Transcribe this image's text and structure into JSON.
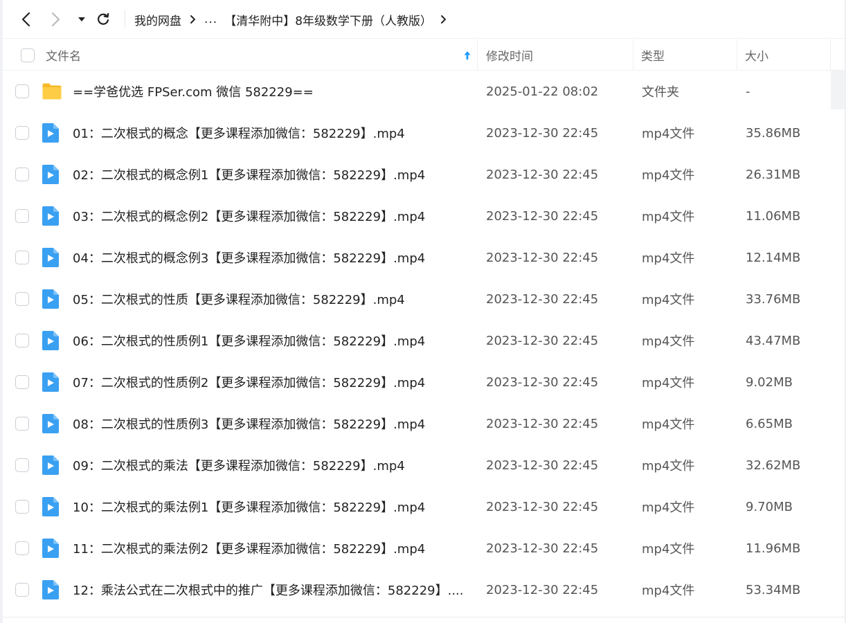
{
  "nav": {
    "back_icon": "chevron-left-icon",
    "forward_icon": "chevron-right-icon",
    "dropdown_icon": "caret-down-icon",
    "refresh_icon": "refresh-icon"
  },
  "breadcrumb": {
    "root": "我的网盘",
    "ellipsis": "...",
    "current": "【清华附中】8年级数学下册（人教版）"
  },
  "table": {
    "headers": {
      "name": "文件名",
      "modified": "修改时间",
      "type": "类型",
      "size": "大小"
    },
    "sort_icon": "arrow-up-icon",
    "rows": [
      {
        "icon": "folder-icon",
        "name": "==学爸优选 FPSer.com 微信 582229==",
        "modified": "2025-01-22 08:02",
        "type": "文件夹",
        "size": "-"
      },
      {
        "icon": "video-file-icon",
        "name": "01：二次根式的概念【更多课程添加微信：582229】.mp4",
        "modified": "2023-12-30 22:45",
        "type": "mp4文件",
        "size": "35.86MB"
      },
      {
        "icon": "video-file-icon",
        "name": "02：二次根式的概念例1【更多课程添加微信：582229】.mp4",
        "modified": "2023-12-30 22:45",
        "type": "mp4文件",
        "size": "26.31MB"
      },
      {
        "icon": "video-file-icon",
        "name": "03：二次根式的概念例2【更多课程添加微信：582229】.mp4",
        "modified": "2023-12-30 22:45",
        "type": "mp4文件",
        "size": "11.06MB"
      },
      {
        "icon": "video-file-icon",
        "name": "04：二次根式的概念例3【更多课程添加微信：582229】.mp4",
        "modified": "2023-12-30 22:45",
        "type": "mp4文件",
        "size": "12.14MB"
      },
      {
        "icon": "video-file-icon",
        "name": "05：二次根式的性质【更多课程添加微信：582229】.mp4",
        "modified": "2023-12-30 22:45",
        "type": "mp4文件",
        "size": "33.76MB"
      },
      {
        "icon": "video-file-icon",
        "name": "06：二次根式的性质例1【更多课程添加微信：582229】.mp4",
        "modified": "2023-12-30 22:45",
        "type": "mp4文件",
        "size": "43.47MB"
      },
      {
        "icon": "video-file-icon",
        "name": "07：二次根式的性质例2【更多课程添加微信：582229】.mp4",
        "modified": "2023-12-30 22:45",
        "type": "mp4文件",
        "size": "9.02MB"
      },
      {
        "icon": "video-file-icon",
        "name": "08：二次根式的性质例3【更多课程添加微信：582229】.mp4",
        "modified": "2023-12-30 22:45",
        "type": "mp4文件",
        "size": "6.65MB"
      },
      {
        "icon": "video-file-icon",
        "name": "09：二次根式的乘法【更多课程添加微信：582229】.mp4",
        "modified": "2023-12-30 22:45",
        "type": "mp4文件",
        "size": "32.62MB"
      },
      {
        "icon": "video-file-icon",
        "name": "10：二次根式的乘法例1【更多课程添加微信：582229】.mp4",
        "modified": "2023-12-30 22:45",
        "type": "mp4文件",
        "size": "9.70MB"
      },
      {
        "icon": "video-file-icon",
        "name": "11：二次根式的乘法例2【更多课程添加微信：582229】.mp4",
        "modified": "2023-12-30 22:45",
        "type": "mp4文件",
        "size": "11.96MB"
      },
      {
        "icon": "video-file-icon",
        "name": "12：乘法公式在二次根式中的推广【更多课程添加微信：582229】....",
        "modified": "2023-12-30 22:45",
        "type": "mp4文件",
        "size": "53.34MB"
      }
    ]
  },
  "colors": {
    "accent": "#1e9bff",
    "folder": "#ffc93a",
    "video_icon": "#3aa0f2"
  }
}
